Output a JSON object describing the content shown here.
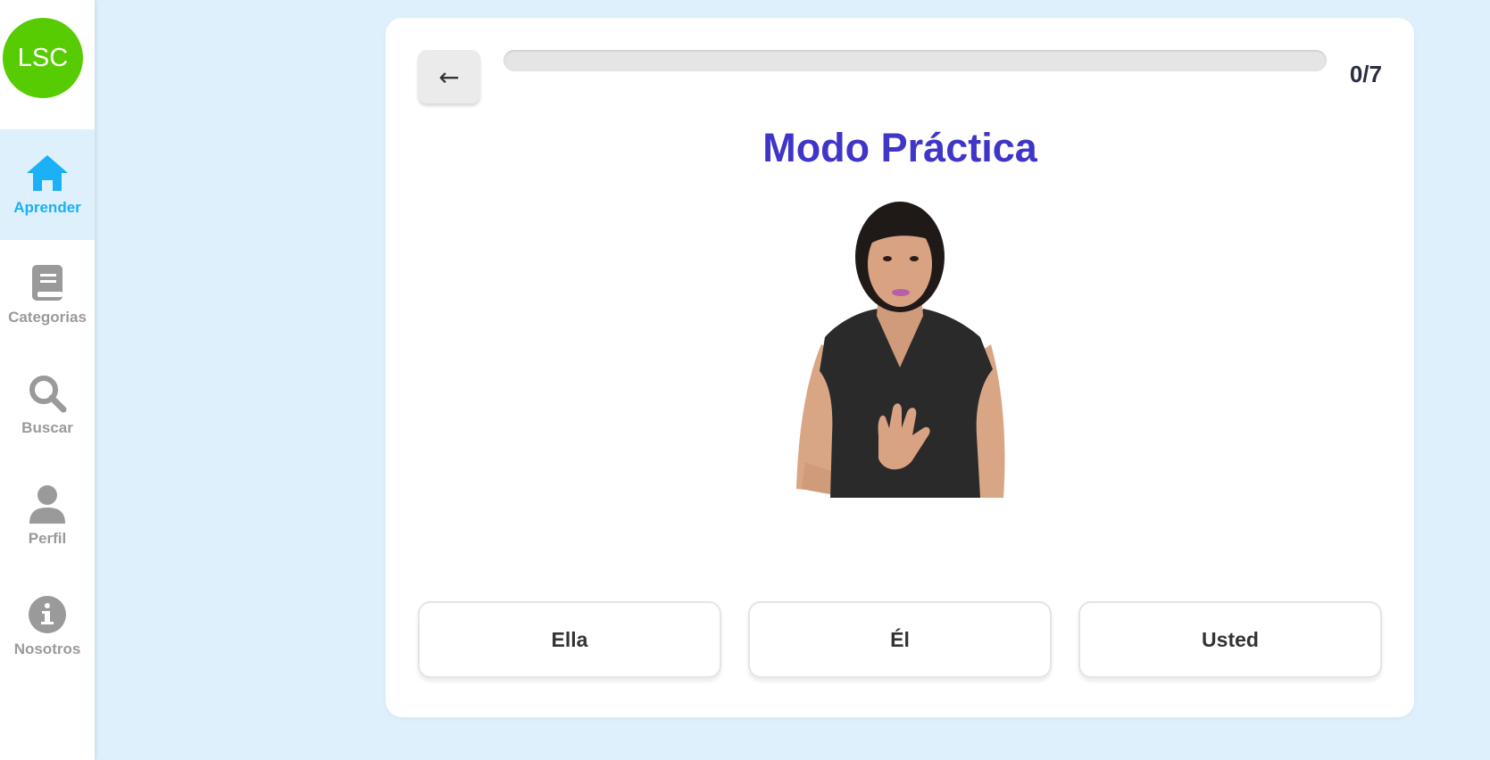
{
  "app": {
    "logo_text": "LSC",
    "colors": {
      "logo_bg": "#58cc02",
      "active_blue": "#1cb0f6",
      "title_purple": "#3f35c8",
      "page_bg": "#ddf0fc"
    }
  },
  "sidebar": {
    "items": [
      {
        "label": "Aprender",
        "icon": "home-icon",
        "active": true
      },
      {
        "label": "Categorias",
        "icon": "book-icon",
        "active": false
      },
      {
        "label": "Buscar",
        "icon": "search-icon",
        "active": false
      },
      {
        "label": "Perfil",
        "icon": "user-icon",
        "active": false
      },
      {
        "label": "Nosotros",
        "icon": "info-icon",
        "active": false
      }
    ]
  },
  "practice": {
    "back_label": "←",
    "progress_text": "0/7",
    "progress_fraction": 0,
    "title": "Modo Práctica",
    "media_icon": "sign-language-video",
    "options": [
      {
        "label": "Ella"
      },
      {
        "label": "Él"
      },
      {
        "label": "Usted"
      }
    ]
  }
}
